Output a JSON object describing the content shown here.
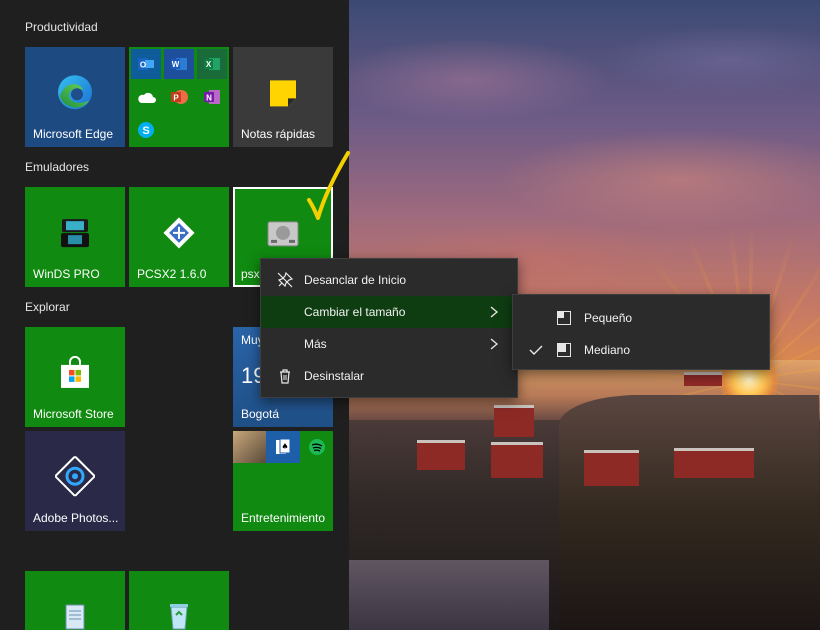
{
  "groups": {
    "productividad": "Productividad",
    "emuladores": "Emuladores",
    "explorar": "Explorar"
  },
  "tiles": {
    "edge": "Microsoft Edge",
    "notas": "Notas rápidas",
    "winds": "WinDS PRO",
    "pcsx2": "PCSX2 1.6.0",
    "psx": "psx",
    "store": "Microsoft Store",
    "weather_partial": "Muy",
    "weather_temp": "19",
    "weather_city": "Bogotá",
    "photoshop": "Adobe Photos...",
    "entretenimiento": "Entretenimiento"
  },
  "office_apps": [
    "Outlook",
    "Word",
    "Excel",
    "OneDrive",
    "PowerPoint",
    "OneNote",
    "Skype"
  ],
  "context_menu": {
    "items": [
      {
        "label": "Desanclar de Inicio",
        "icon": "unpin-icon"
      },
      {
        "label": "Cambiar el tamaño",
        "icon": "",
        "submenu": true
      },
      {
        "label": "Más",
        "icon": "",
        "submenu": true
      },
      {
        "label": "Desinstalar",
        "icon": "trash-icon"
      }
    ]
  },
  "resize_submenu": {
    "items": [
      {
        "label": "Pequeño",
        "checked": false
      },
      {
        "label": "Mediano",
        "checked": true
      }
    ]
  },
  "colors": {
    "tile_green": "#108a10",
    "menu_bg": "#2b2b2b",
    "menu_active": "#0f3d12",
    "annotation": "#f5d000"
  }
}
